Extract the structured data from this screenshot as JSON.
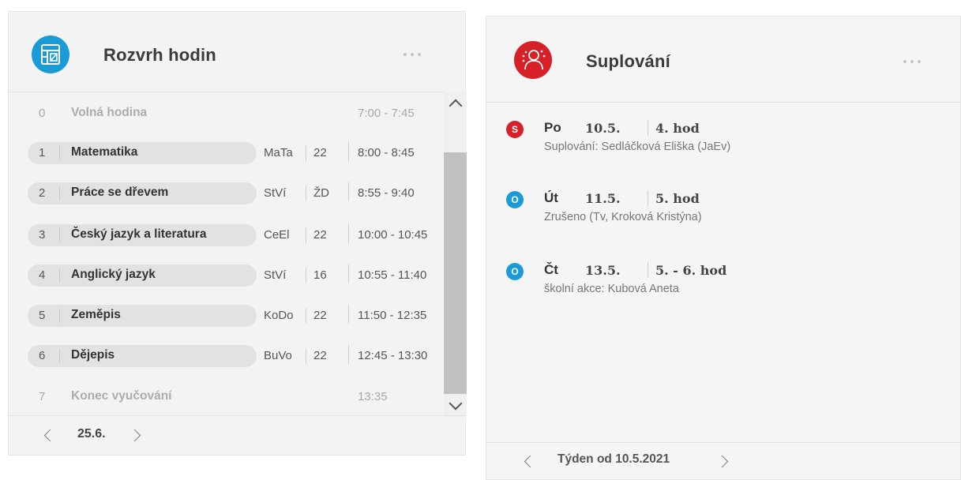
{
  "timetable": {
    "title": "Rozvrh hodin",
    "accent": "#1a9ad6",
    "icon": "timetable-icon",
    "rows": [
      {
        "num": "0",
        "subject": "Volná hodina",
        "teacher": "",
        "room": "",
        "time": "7:00 - 7:45",
        "active": false
      },
      {
        "num": "1",
        "subject": "Matematika",
        "teacher": "MaTa",
        "room": "22",
        "time": "8:00 - 8:45",
        "active": true
      },
      {
        "num": "2",
        "subject": "Práce se dřevem",
        "teacher": "StVí",
        "room": "ŽD",
        "time": "8:55 - 9:40",
        "active": true
      },
      {
        "num": "3",
        "subject": "Český jazyk a literatura",
        "teacher": "CeEl",
        "room": "22",
        "time": "10:00 - 10:45",
        "active": true
      },
      {
        "num": "4",
        "subject": "Anglický jazyk",
        "teacher": "StVí",
        "room": "16",
        "time": "10:55 - 11:40",
        "active": true
      },
      {
        "num": "5",
        "subject": "Zeměpis",
        "teacher": "KoDo",
        "room": "22",
        "time": "11:50 - 12:35",
        "active": true
      },
      {
        "num": "6",
        "subject": "Dějepis",
        "teacher": "BuVo",
        "room": "22",
        "time": "12:45 - 13:30",
        "active": true
      },
      {
        "num": "7",
        "subject": "Konec vyučování",
        "teacher": "",
        "room": "",
        "time": "13:35",
        "active": false
      }
    ],
    "footer_date": "25.6."
  },
  "substitutions": {
    "title": "Suplování",
    "accent": "#d62128",
    "icon": "substitution-person-icon",
    "items": [
      {
        "badge": "S",
        "badge_color": "#d62128",
        "day": "Po",
        "date": "10.5.",
        "hour": "4. hod",
        "description": "Suplování: Sedláčková Eliška (JaEv)"
      },
      {
        "badge": "O",
        "badge_color": "#1a9ad6",
        "day": "Út",
        "date": "11.5.",
        "hour": "5. hod",
        "description": "Zrušeno (Tv, Kroková Kristýna)"
      },
      {
        "badge": "O",
        "badge_color": "#1a9ad6",
        "day": "Čt",
        "date": "13.5.",
        "hour": "5. - 6. hod",
        "description": "školní akce: Kubová Aneta"
      }
    ],
    "footer_label": "Týden od 10.5.2021"
  }
}
